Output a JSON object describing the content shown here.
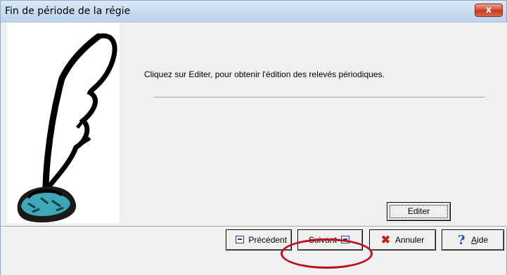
{
  "window": {
    "title": "Fin de période de la régie",
    "close_glyph": "x"
  },
  "main": {
    "instruction": "Cliquez sur Editer, pour obtenir l'édition des relevés périodiques."
  },
  "buttons": {
    "editer": "Editer",
    "precedent": "Précédent",
    "suivant": "Suivant",
    "annuler": "Annuler",
    "aide_first": "A",
    "aide_rest": "ide"
  },
  "icons": {
    "quill": "quill-and-inkwell-icon",
    "prev": "prev-icon",
    "next": "next-icon",
    "cancel": "cancel-x-icon",
    "help": "help-question-icon"
  },
  "colors": {
    "highlight": "#c00d1e",
    "close": "#c8391c"
  }
}
